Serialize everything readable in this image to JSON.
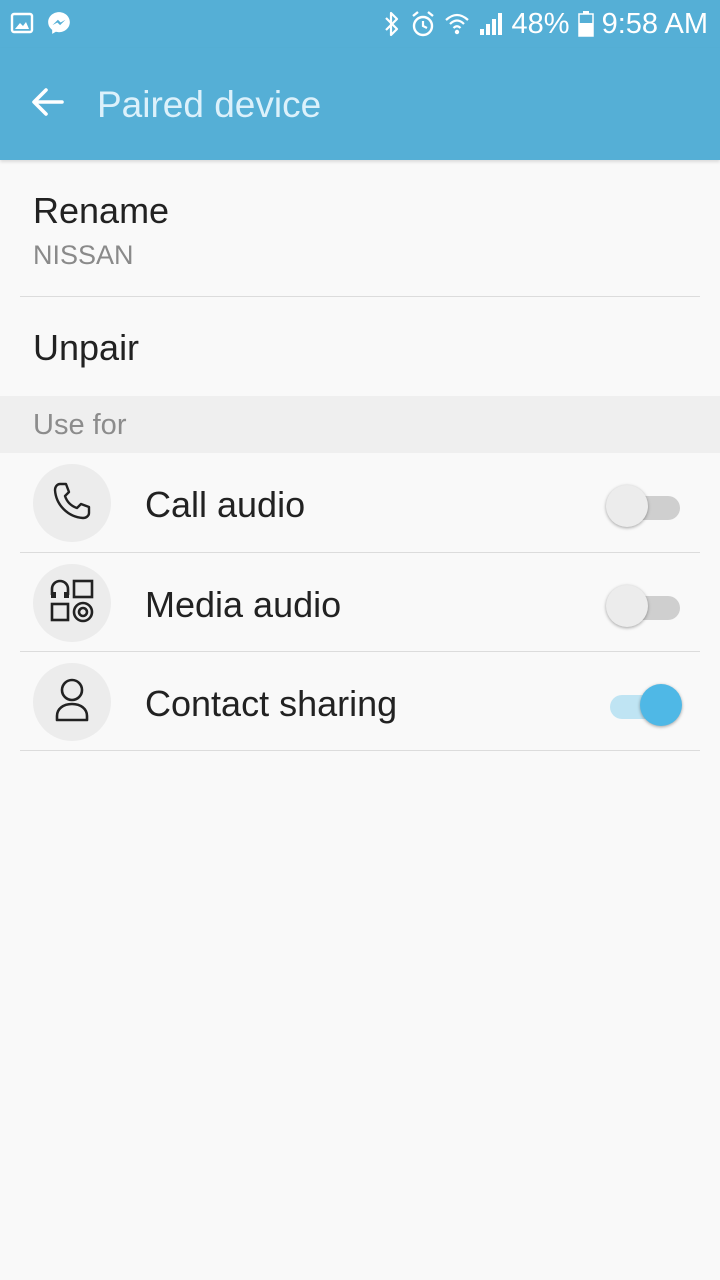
{
  "status_bar": {
    "battery": "48%",
    "time": "9:58 AM",
    "icons": [
      "gallery-icon",
      "messenger-icon",
      "bluetooth-icon",
      "alarm-icon",
      "wifi-icon",
      "signal-icon",
      "battery-icon"
    ]
  },
  "app_bar": {
    "title": "Paired device",
    "back_icon": "arrow-back-icon",
    "color": "#55afd6"
  },
  "rename": {
    "label": "Rename",
    "value": "NISSAN"
  },
  "unpair": {
    "label": "Unpair"
  },
  "use_for": {
    "header": "Use for",
    "items": [
      {
        "label": "Call audio",
        "icon": "phone-icon",
        "enabled": false
      },
      {
        "label": "Media audio",
        "icon": "media-icon",
        "enabled": false
      },
      {
        "label": "Contact sharing",
        "icon": "person-icon",
        "enabled": true
      }
    ]
  },
  "colors": {
    "accent": "#4fb8e6",
    "text_primary": "#222222",
    "text_secondary": "#8a8a8a"
  }
}
